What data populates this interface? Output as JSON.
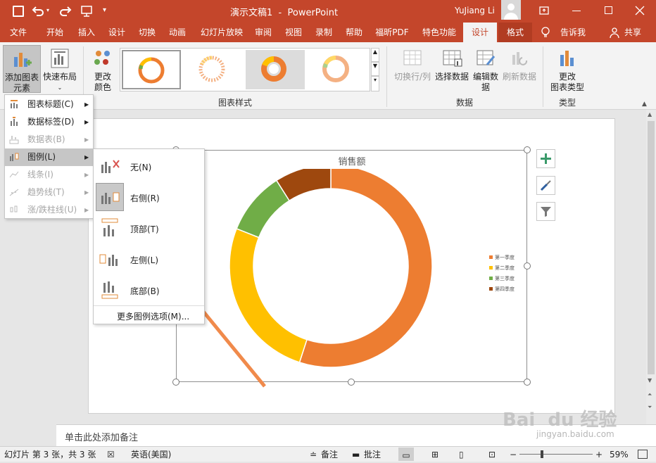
{
  "window": {
    "title": "演示文稿1  -  PowerPoint",
    "user": "YuJiang Li"
  },
  "tabs": [
    "文件",
    "开始",
    "插入",
    "设计",
    "切换",
    "动画",
    "幻灯片放映",
    "审阅",
    "视图",
    "录制",
    "帮助",
    "福昕PDF",
    "特色功能",
    "设计",
    "格式"
  ],
  "tell_me": "告诉我",
  "share": "共享",
  "ribbon": {
    "add_element_line1": "添加图表",
    "add_element_line2": "元素",
    "quick_layout": "快速布局",
    "change_colors_line1": "更改",
    "change_colors_line2": "颜色",
    "group_chart_styles": "图表样式",
    "switch_row_col": "切换行/列",
    "select_data": "选择数据",
    "edit_data_line1": "编辑数",
    "edit_data_line2": "据",
    "refresh_data": "刷新数据",
    "group_data": "数据",
    "change_type_line1": "更改",
    "change_type_line2": "图表类型",
    "group_type": "类型"
  },
  "menu_add_element": [
    {
      "label": "图表标题(C)",
      "disabled": false,
      "highlighted": false
    },
    {
      "label": "数据标签(D)",
      "disabled": false,
      "highlighted": false
    },
    {
      "label": "数据表(B)",
      "disabled": true,
      "highlighted": false
    },
    {
      "label": "图例(L)",
      "disabled": false,
      "highlighted": true
    },
    {
      "label": "线条(I)",
      "disabled": true,
      "highlighted": false
    },
    {
      "label": "趋势线(T)",
      "disabled": true,
      "highlighted": false
    },
    {
      "label": "涨/跌柱线(U)",
      "disabled": true,
      "highlighted": false
    }
  ],
  "menu_legend": [
    {
      "label": "无(N)",
      "icon": "legend-none-icon",
      "selected": false
    },
    {
      "label": "右侧(R)",
      "icon": "legend-right-icon",
      "selected": true
    },
    {
      "label": "顶部(T)",
      "icon": "legend-top-icon",
      "selected": false
    },
    {
      "label": "左侧(L)",
      "icon": "legend-left-icon",
      "selected": false
    },
    {
      "label": "底部(B)",
      "icon": "legend-bottom-icon",
      "selected": false
    }
  ],
  "menu_legend_more": "更多图例选项(M)...",
  "chart_data": {
    "type": "donut",
    "title": "销售额",
    "categories": [
      "第一季度",
      "第二季度",
      "第三季度",
      "第四季度"
    ],
    "values": [
      55,
      26,
      10,
      9
    ],
    "colors": [
      "#ed7d31",
      "#ffc000",
      "#70ad47",
      "#9e480e"
    ],
    "legend_position": "right"
  },
  "notes_placeholder": "单击此处添加备注",
  "status": {
    "slide_info": "幻灯片 第 3 张，共 3 张",
    "language": "英语(美国)",
    "notes": "备注",
    "comments": "批注",
    "zoom": "59%"
  },
  "watermark": {
    "brand": "Bai  du 经验",
    "url": "jingyan.baidu.com"
  }
}
